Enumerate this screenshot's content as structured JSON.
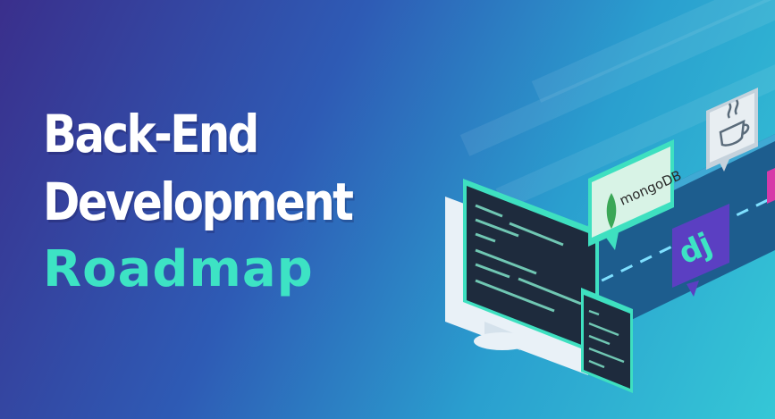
{
  "headline": {
    "line1": "Back-End",
    "line2": "Development",
    "line3": "Roadmap"
  },
  "badges": {
    "mongodb": "mongoDB",
    "django": "dj"
  },
  "icons": [
    "mongodb-leaf-icon",
    "java-cup-icon",
    "django-icon",
    "code-tag-icon"
  ],
  "colors": {
    "background_start": "#3a2f8c",
    "background_end": "#35c7d6",
    "accent": "#3de3c4",
    "headline_text": "#ffffff",
    "django_badge": "#5b3fc2",
    "java_badge": "#e8eef2",
    "mongodb_badge": "#d8f3e6"
  }
}
